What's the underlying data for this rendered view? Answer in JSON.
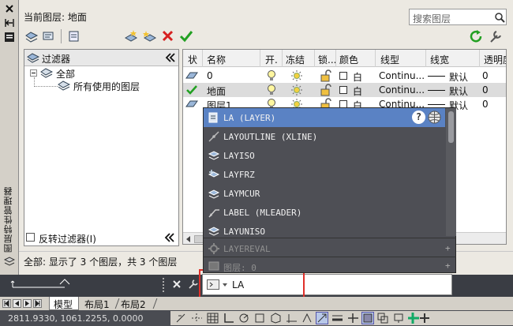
{
  "palette": {
    "current_layer": "当前图层: 地面",
    "search_placeholder": "搜索图层",
    "side_title": "图层特性管理器"
  },
  "filters": {
    "header": "过滤器",
    "all": "全部",
    "used": "所有使用的图层",
    "invert": "反转过滤器(I)"
  },
  "columns": [
    "状",
    "名称",
    "开.",
    "冻结",
    "锁...",
    "颜色",
    "线型",
    "线宽",
    "透明度"
  ],
  "layers": [
    {
      "name": "0",
      "color": "白",
      "linetype": "Continu...",
      "lineweight": "默认",
      "transparency": "0"
    },
    {
      "name": "地面",
      "color": "白",
      "linetype": "Continu...",
      "lineweight": "默认",
      "transparency": "0"
    },
    {
      "name": "图层1",
      "color": "白",
      "linetype": "Continu...",
      "lineweight": "默认",
      "transparency": "0"
    }
  ],
  "status_text": "全部: 显示了 3 个图层，共 3 个图层",
  "autocomplete": {
    "items": [
      "LA (LAYER)",
      "LAYOUTLINE (XLINE)",
      "LAYISO",
      "LAYFRZ",
      "LAYMCUR",
      "LABEL (MLEADER)",
      "LAYUNISO"
    ],
    "sections": [
      "LAYEREVAL",
      "图层: 0"
    ]
  },
  "command": {
    "input": "LA"
  },
  "tabs": [
    "模型",
    "布局1",
    "布局2"
  ],
  "coords": "2811.9330, 1061.2255, 0.0000",
  "colors": {
    "highlight": "#5a82c4",
    "annotation_box": "#e0302a",
    "check_green": "#22a022"
  }
}
